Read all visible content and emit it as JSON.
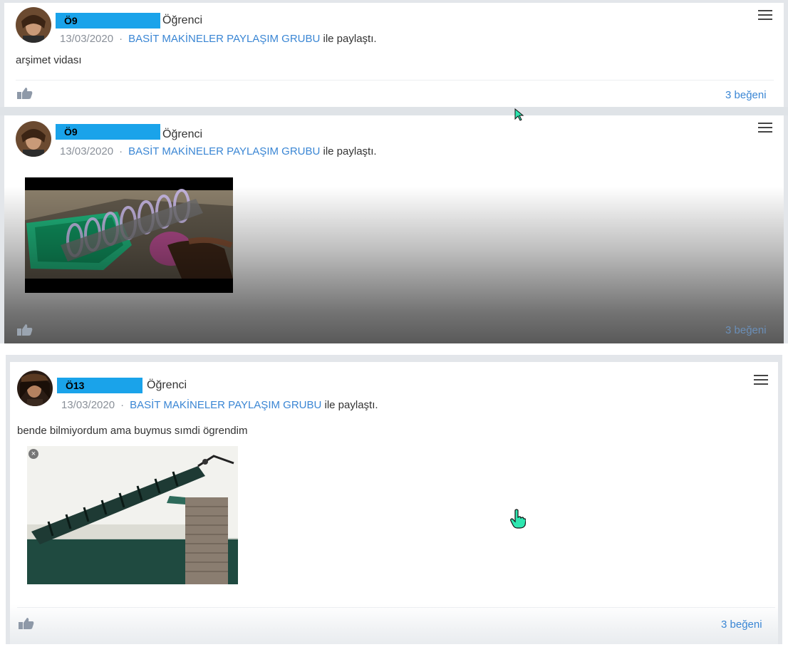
{
  "posts": [
    {
      "author": "Ö9",
      "role": "Öğrenci",
      "date": "13/03/2020",
      "separator": "·",
      "group": "BASİT MAKİNELER PAYLAŞIM GRUBU",
      "action": "ile paylaştı.",
      "text": "arşimet vidası",
      "likes": "3 beğeni",
      "icons": {
        "menu": "hamburger-menu-icon",
        "like": "thumbs-up-icon"
      }
    },
    {
      "author": "Ö9",
      "role": "Öğrenci",
      "date": "13/03/2020",
      "separator": "·",
      "group": "BASİT MAKİNELER PAYLAŞIM GRUBU",
      "action": "ile paylaştı.",
      "media": "video-thumbnail",
      "likes": "3 beğeni",
      "icons": {
        "menu": "hamburger-menu-icon",
        "like": "thumbs-up-icon"
      }
    },
    {
      "author": "Ö13",
      "role": "Öğrenci",
      "date": "13/03/2020",
      "separator": "·",
      "group": "BASİT MAKİNELER PAYLAŞIM GRUBU",
      "action": "ile paylaştı.",
      "text": "bende bilmiyordum ama buymus sımdi ögrendim",
      "media": "archimedes-screw-illustration",
      "likes": "3 beğeni",
      "icons": {
        "menu": "hamburger-menu-icon",
        "like": "thumbs-up-icon",
        "close": "close-icon"
      }
    }
  ],
  "colors": {
    "name_highlight": "#1aa3ea",
    "link": "#3a86d4",
    "meta": "#8a9099",
    "cursor": "#2ee6b0"
  }
}
